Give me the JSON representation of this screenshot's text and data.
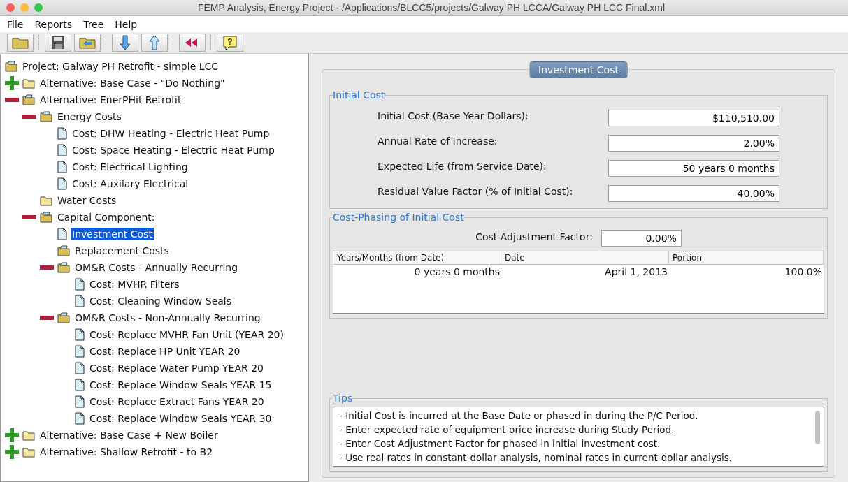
{
  "window": {
    "title": "FEMP Analysis, Energy Project - /Applications/BLCC5/projects/Galway PH LCCA/Galway PH LCC Final.xml"
  },
  "menu": [
    "File",
    "Reports",
    "Tree",
    "Help"
  ],
  "toolbar": [
    {
      "kind": "open"
    },
    {
      "kind": "save"
    },
    {
      "kind": "import"
    },
    {
      "kind": "down"
    },
    {
      "kind": "up"
    },
    {
      "kind": "back"
    },
    {
      "kind": "help",
      "text": "?"
    }
  ],
  "tree": [
    {
      "label": "Project: Galway PH Retrofit - simple LCC",
      "kind": "project",
      "selected": false
    },
    {
      "label": "Alternative: Base Case - \"Do Nothing\"",
      "kind": "folder",
      "expanded": false,
      "selected": false
    },
    {
      "label": "Alternative: EnerPHit Retrofit",
      "kind": "openfolder",
      "expanded": true,
      "selected": false,
      "children": [
        {
          "label": "Energy Costs",
          "kind": "openfolder",
          "expanded": true,
          "selected": false,
          "children": [
            {
              "label": "Cost: DHW Heating - Electric Heat Pump",
              "kind": "doc",
              "selected": false
            },
            {
              "label": "Cost: Space Heating - Electric Heat Pump",
              "kind": "doc",
              "selected": false
            },
            {
              "label": "Cost: Electrical Lighting",
              "kind": "doc",
              "selected": false
            },
            {
              "label": "Cost: Auxilary Electrical",
              "kind": "doc",
              "selected": false
            }
          ]
        },
        {
          "label": "Water Costs",
          "kind": "folder",
          "selected": false
        },
        {
          "label": "Capital Component:",
          "kind": "openfolder",
          "expanded": true,
          "selected": false,
          "children": [
            {
              "label": "Investment Cost",
              "kind": "doc",
              "selected": true
            },
            {
              "label": "Replacement Costs",
              "kind": "openfolder",
              "selected": false
            },
            {
              "label": "OM&R Costs - Annually Recurring",
              "kind": "openfolder",
              "expanded": true,
              "selected": false,
              "children": [
                {
                  "label": "Cost: MVHR Filters",
                  "kind": "doc",
                  "selected": false
                },
                {
                  "label": "Cost: Cleaning Window Seals",
                  "kind": "doc",
                  "selected": false
                }
              ]
            },
            {
              "label": "OM&R Costs - Non-Annually Recurring",
              "kind": "openfolder",
              "expanded": true,
              "selected": false,
              "children": [
                {
                  "label": "Cost: Replace MVHR Fan Unit (YEAR 20)",
                  "kind": "doc",
                  "selected": false
                },
                {
                  "label": "Cost: Replace HP Unit YEAR 20",
                  "kind": "doc",
                  "selected": false
                },
                {
                  "label": "Cost: Replace Water Pump YEAR 20",
                  "kind": "doc",
                  "selected": false
                },
                {
                  "label": "Cost: Replace Window Seals YEAR 15",
                  "kind": "doc",
                  "selected": false
                },
                {
                  "label": "Cost: Replace Extract Fans YEAR 20",
                  "kind": "doc",
                  "selected": false
                },
                {
                  "label": "Cost: Replace Window Seals YEAR 30",
                  "kind": "doc",
                  "selected": false
                }
              ]
            }
          ]
        }
      ]
    },
    {
      "label": "Alternative: Base Case + New Boiler",
      "kind": "folder",
      "expanded": false,
      "selected": false
    },
    {
      "label": "Alternative: Shallow Retrofit - to B2",
      "kind": "folder",
      "expanded": false,
      "selected": false
    }
  ],
  "panel": {
    "title": "Investment Cost",
    "initial_cost": {
      "heading": "Initial Cost",
      "fields": [
        {
          "label": "Initial Cost (Base Year Dollars):",
          "value": "$110,510.00"
        },
        {
          "label": "Annual Rate of Increase:",
          "value": "2.00%"
        },
        {
          "label": "Expected Life (from Service Date):",
          "value": "50 years 0 months"
        },
        {
          "label": "Residual Value Factor (% of Initial Cost):",
          "value": "40.00%"
        }
      ]
    },
    "phasing": {
      "heading": "Cost-Phasing of Initial Cost",
      "factor_label": "Cost Adjustment Factor:",
      "factor_value": "0.00%",
      "columns": [
        "Years/Months (from Date)",
        "Date",
        "Portion"
      ],
      "rows": [
        [
          "0 years 0 months",
          "April 1, 2013",
          "100.0%"
        ]
      ]
    },
    "tips": {
      "heading": "Tips",
      "lines": [
        "- Initial Cost is incurred at the Base Date or phased in during the P/C Period.",
        "- Enter expected rate of equipment price increase during Study Period.",
        "- Enter Cost Adjustment Factor for phased-in initial investment cost.",
        "- Use real rates in constant-dollar analysis, nominal rates in current-dollar analysis."
      ]
    }
  }
}
